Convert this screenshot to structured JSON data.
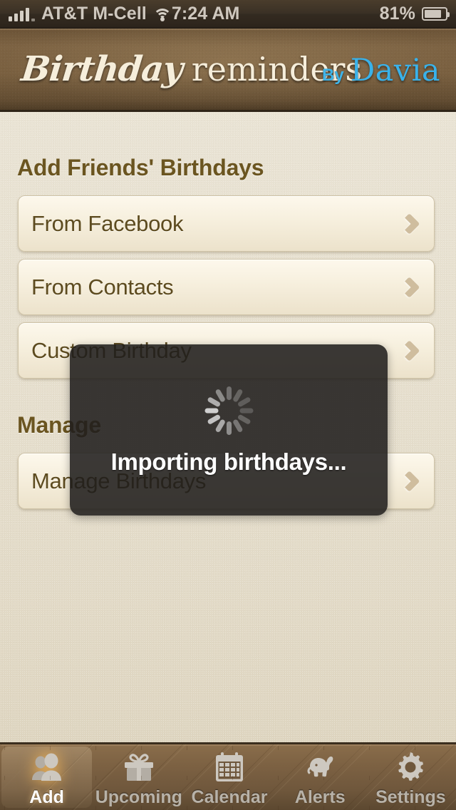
{
  "status_bar": {
    "carrier": "AT&T M-Cell",
    "time": "7:24 AM",
    "battery_percent": "81%",
    "signal_icon": "signal-bars-icon",
    "wifi_icon": "wifi-icon",
    "battery_icon": "battery-icon"
  },
  "header": {
    "title_script": "Birthday",
    "title_serif": "reminders",
    "by_label": "By",
    "brand": "Davia",
    "brand_color": "#39b2ea"
  },
  "main": {
    "sections": [
      {
        "title": "Add Friends' Birthdays",
        "rows": [
          {
            "label": "From Facebook",
            "chevron": "chevron-right-icon"
          },
          {
            "label": "From Contacts",
            "chevron": "chevron-right-icon"
          },
          {
            "label": "Custom Birthday",
            "chevron": "chevron-right-icon"
          }
        ]
      },
      {
        "title": "Manage",
        "rows": [
          {
            "label": "Manage Birthdays",
            "chevron": "chevron-right-icon"
          }
        ]
      }
    ]
  },
  "modal": {
    "message": "Importing birthdays...",
    "spinner_icon": "activity-spinner-icon",
    "background_color": "#201e1c"
  },
  "tab_bar": {
    "active_index": 0,
    "tabs": [
      {
        "label": "Add",
        "icon": "people-icon"
      },
      {
        "label": "Upcoming",
        "icon": "gift-icon"
      },
      {
        "label": "Calendar",
        "icon": "calendar-icon"
      },
      {
        "label": "Alerts",
        "icon": "elephant-icon"
      },
      {
        "label": "Settings",
        "icon": "gear-icon"
      }
    ]
  }
}
